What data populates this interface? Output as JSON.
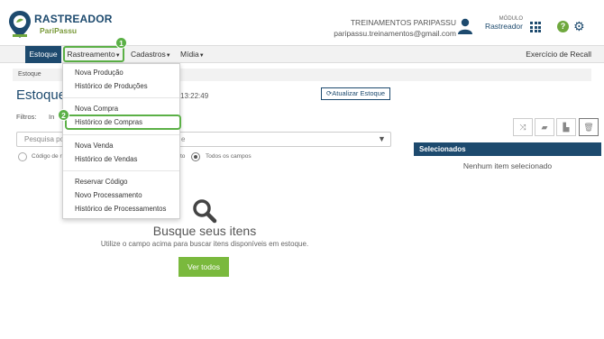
{
  "brand": {
    "name": "RASTREADOR",
    "sub": "PariPassu"
  },
  "user": {
    "name": "TREINAMENTOS PARIPASSU",
    "email": "paripassu.treinamentos@gmail.com"
  },
  "module": {
    "label": "MÓDULO",
    "value": "Rastreador"
  },
  "nav": {
    "estoque": "Estoque",
    "rastreamento": "Rastreamento",
    "cadastros": "Cadastros",
    "midia": "Mídia",
    "recall": "Exercício de Recall"
  },
  "steps": {
    "one": "1",
    "two": "2"
  },
  "breadcrumb": "Estoque",
  "page": {
    "title": "Estoque",
    "time": "13:22:49",
    "refresh": "Atualizar Estoque",
    "filters": "Filtros:",
    "filters_in": "In",
    "search_placeholder": "Pesquisa po",
    "search_tail": "e",
    "radio_code": "Código de r",
    "radio_to": "to",
    "radio_all": "Todos os campos"
  },
  "selected": {
    "header": "Selecionados",
    "empty": "Nenhum item selecionado"
  },
  "empty_state": {
    "title": "Busque seus itens",
    "subtitle": "Utilize o campo acima para buscar itens disponíveis em estoque.",
    "button": "Ver todos"
  },
  "dropdown": {
    "items": [
      "Nova Produção",
      "Histórico de Produções",
      "Nova Compra",
      "Histórico de Compras",
      "Nova Venda",
      "Histórico de Vendas",
      "Reservar Código",
      "Novo Processamento",
      "Histórico de Processamentos"
    ]
  },
  "colors": {
    "primary": "#1d4a6e",
    "accent": "#5bb046",
    "button": "#7ab93d"
  },
  "icons": [
    "logo-icon",
    "user-icon",
    "grid-icon",
    "help-icon",
    "gear-icon",
    "refresh-icon",
    "filter-icon",
    "shuffle-icon",
    "truck-icon",
    "chart-icon",
    "trash-icon",
    "search-icon"
  ]
}
